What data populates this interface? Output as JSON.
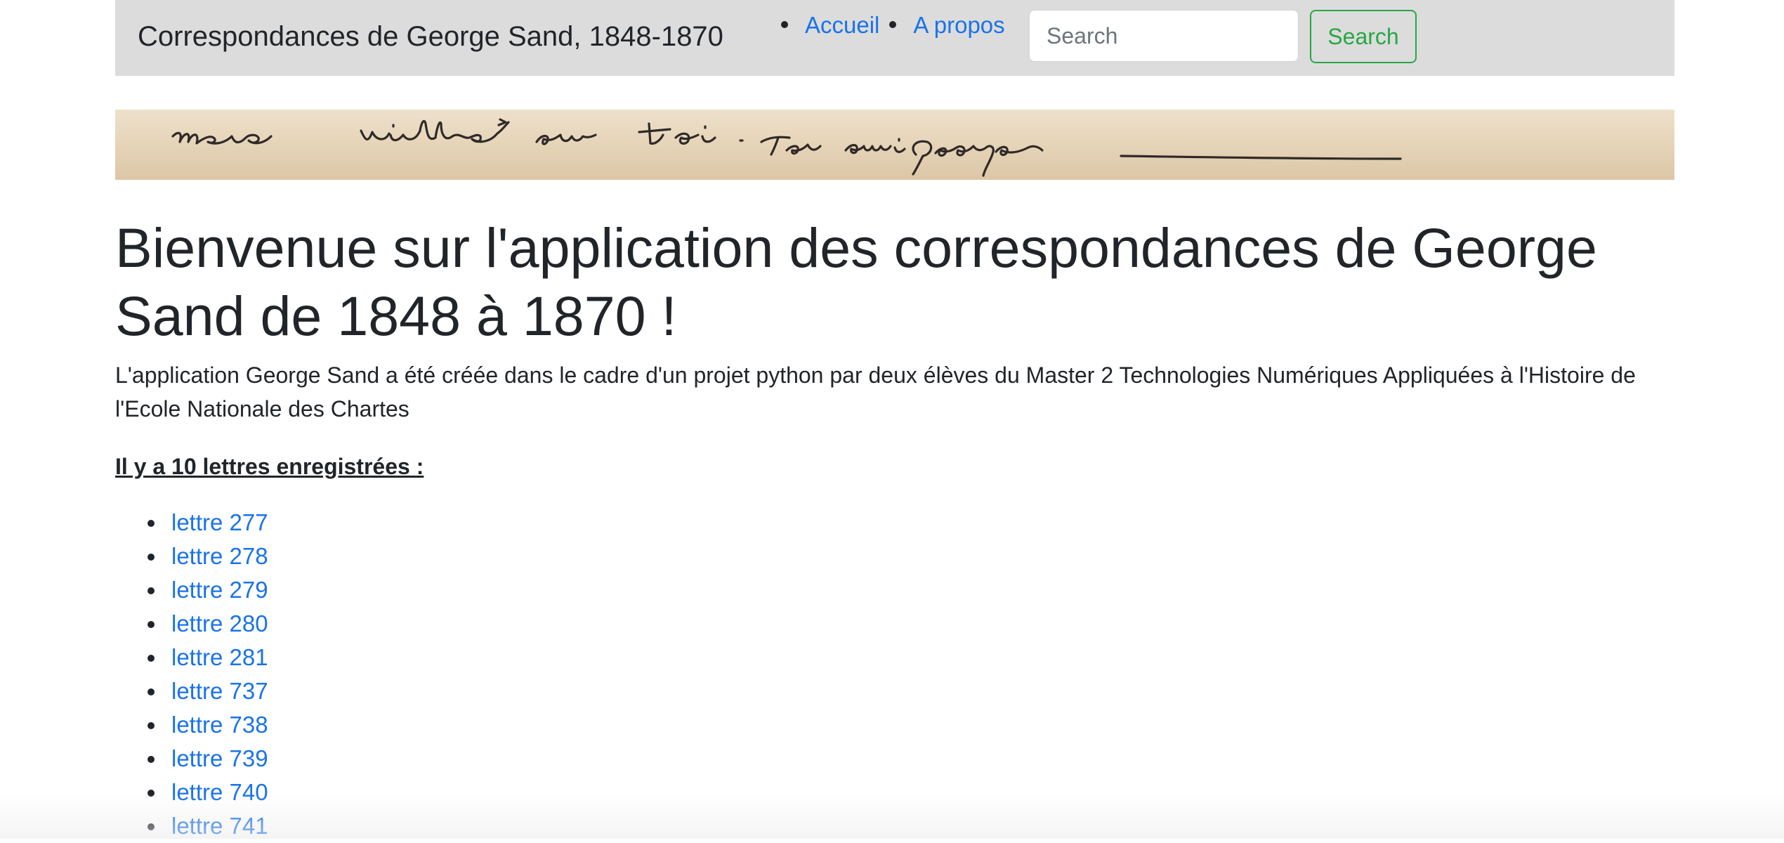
{
  "navbar": {
    "brand": "Correspondances de George Sand, 1848-1870",
    "links": [
      {
        "label": "Accueil"
      },
      {
        "label": "A propos"
      }
    ],
    "search": {
      "placeholder": "Search",
      "value": "",
      "button_label": "Search"
    }
  },
  "banner": {
    "handwriting": "mère vieillisse sur toi . Ton ami George"
  },
  "main": {
    "title": "Bienvenue sur l'application des correspondances de George Sand de 1848 à 1870 !",
    "intro": "L'application George Sand a été créée dans le cadre d'un projet python par deux élèves du Master 2 Technologies Numériques Appliquées à l'Histoire de l'Ecole Nationale des Chartes",
    "count_heading": "Il y a 10 lettres enregistrées :",
    "letters": [
      "lettre 277",
      "lettre 278",
      "lettre 279",
      "lettre 280",
      "lettre 281",
      "lettre 737",
      "lettre 738",
      "lettre 739",
      "lettre 740",
      "lettre 741"
    ]
  },
  "colors": {
    "navbar_bg": "#dcdcdc",
    "link": "#1a73e8",
    "success": "#28a745",
    "text": "#212529",
    "banner_paper": "#e6d4b8"
  }
}
